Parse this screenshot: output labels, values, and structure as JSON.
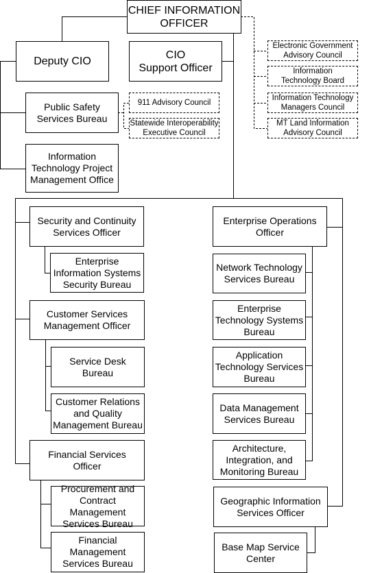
{
  "chief": "CHIEF INFORMATION\nOFFICER",
  "deputy": "Deputy CIO",
  "support": "CIO\nSupport Officer",
  "public_safety": "Public Safety\nServices Bureau",
  "pmo": "Information\nTechnology Project\nManagement Office",
  "councils_ps": [
    "911 Advisory Council",
    "Statewide Interoperability\nExecutive Council"
  ],
  "councils_cio": [
    "Electronic Government\nAdvisory Council",
    "Information\nTechnology Board",
    "Information Technology\nManagers Council",
    "MT Land Information\nAdvisory Council"
  ],
  "left": {
    "security_officer": "Security and Continuity\nServices Officer",
    "eiss_bureau": "Enterprise\nInformation Systems\nSecurity Bureau",
    "customer_officer": "Customer Services\nManagement Officer",
    "service_desk": "Service Desk\nBureau",
    "customer_relations": "Customer Relations\nand Quality\nManagement Bureau",
    "financial_officer": "Financial Services\nOfficer",
    "procurement": "Procurement and\nContract Management\nServices Bureau",
    "financial_mgmt": "Financial\nManagement\nServices Bureau"
  },
  "right": {
    "eo_officer": "Enterprise Operations\nOfficer",
    "network": "Network Technology\nServices Bureau",
    "ets": "Enterprise\nTechnology Systems\nBureau",
    "ats": "Application\nTechnology Services\nBureau",
    "data": "Data Management\nServices Bureau",
    "aim": "Architecture,\nIntegration, and\nMonitoring Bureau",
    "gis_officer": "Geographic Information\nServices Officer",
    "base_map": "Base Map Service\nCenter"
  }
}
